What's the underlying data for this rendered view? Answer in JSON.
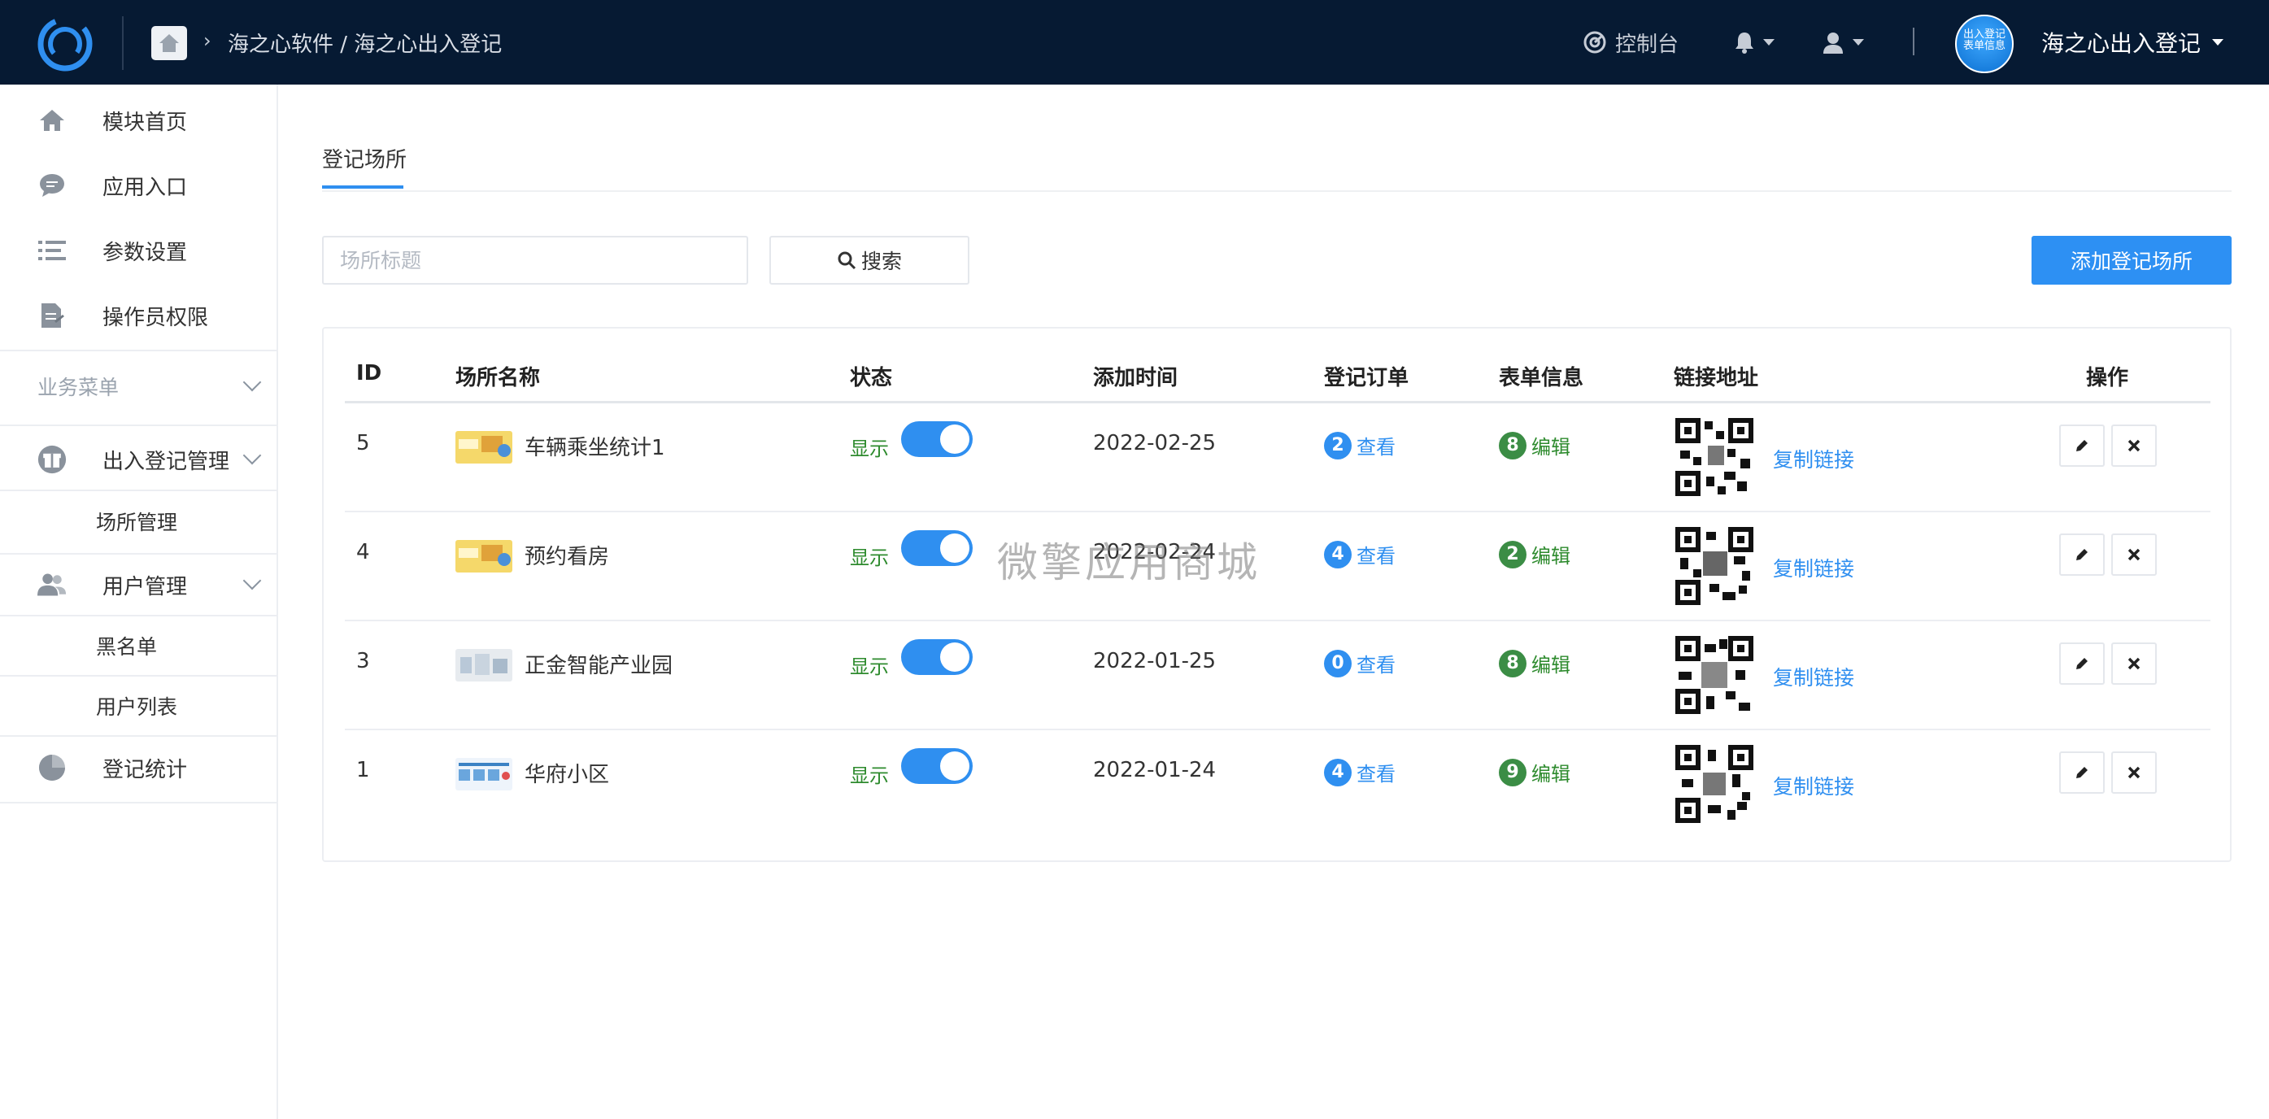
{
  "topbar": {
    "breadcrumb": "海之心软件 / 海之心出入登记",
    "console_label": "控制台",
    "avatar_text": "出入登记 表单信息",
    "user_name": "海之心出入登记"
  },
  "sidebar": {
    "items": [
      {
        "label": "模块首页",
        "icon": "home-icon"
      },
      {
        "label": "应用入口",
        "icon": "chat-icon"
      },
      {
        "label": "参数设置",
        "icon": "list-icon"
      },
      {
        "label": "操作员权限",
        "icon": "document-icon"
      }
    ],
    "group_title": "业务菜单",
    "menu_checkin": "出入登记管理",
    "sub_venue": "场所管理",
    "menu_users": "用户管理",
    "sub_blacklist": "黑名单",
    "sub_userlist": "用户列表",
    "menu_stats": "登记统计"
  },
  "main": {
    "tab_label": "登记场所",
    "search_placeholder": "场所标题",
    "search_button": "搜索",
    "add_button": "添加登记场所",
    "columns": [
      "ID",
      "场所名称",
      "状态",
      "添加时间",
      "登记订单",
      "表单信息",
      "链接地址",
      "操作"
    ],
    "rows": [
      {
        "id": "5",
        "name": "车辆乘坐统计1",
        "status": "显示",
        "date": "2022-02-25",
        "orders": "2",
        "view": "查看",
        "forms": "8",
        "edit": "编辑",
        "copy": "复制链接"
      },
      {
        "id": "4",
        "name": "预约看房",
        "status": "显示",
        "date": "2022-02-24",
        "orders": "4",
        "view": "查看",
        "forms": "2",
        "edit": "编辑",
        "copy": "复制链接"
      },
      {
        "id": "3",
        "name": "正金智能产业园",
        "status": "显示",
        "date": "2022-01-25",
        "orders": "0",
        "view": "查看",
        "forms": "8",
        "edit": "编辑",
        "copy": "复制链接"
      },
      {
        "id": "1",
        "name": "华府小区",
        "status": "显示",
        "date": "2022-01-24",
        "orders": "4",
        "view": "查看",
        "forms": "9",
        "edit": "编辑",
        "copy": "复制链接"
      }
    ]
  },
  "watermark": "微擎应用商城",
  "colors": {
    "topbar": "#061a33",
    "accent": "#2f8ff0",
    "success": "#2e8b2e",
    "badge_green": "#3b8d45"
  }
}
